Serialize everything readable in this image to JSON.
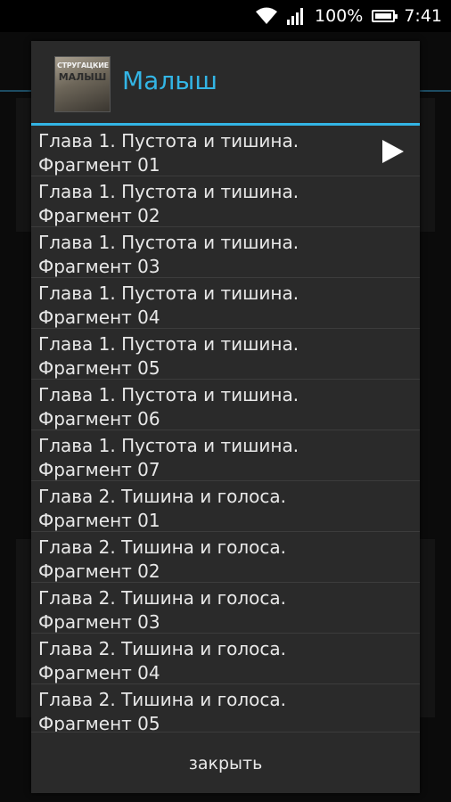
{
  "status_bar": {
    "battery_percent": "100%",
    "time": "7:41",
    "icons": [
      "wifi-icon",
      "signal-icon",
      "battery-icon"
    ]
  },
  "dialog": {
    "title": "Малыш",
    "cover_text_top": "СТРУГАЦКИЕ",
    "cover_text_main": "МАЛЫШ",
    "close_label": "закрыть",
    "accent_color": "#33b5e5",
    "items": [
      {
        "title": "Глава 1. Пустота и тишина.\nФрагмент 01",
        "playing": true
      },
      {
        "title": "Глава 1. Пустота и тишина.\nФрагмент 02"
      },
      {
        "title": "Глава 1. Пустота и тишина.\nФрагмент 03"
      },
      {
        "title": "Глава 1. Пустота и тишина.\nФрагмент 04"
      },
      {
        "title": "Глава 1. Пустота и тишина.\nФрагмент 05"
      },
      {
        "title": "Глава 1. Пустота и тишина.\nФрагмент 06"
      },
      {
        "title": "Глава 1. Пустота и тишина.\nФрагмент 07"
      },
      {
        "title": "Глава 2. Тишина и голоса.\nФрагмент 01"
      },
      {
        "title": "Глава 2. Тишина и голоса.\nФрагмент 02"
      },
      {
        "title": "Глава 2. Тишина и голоса.\nФрагмент 03"
      },
      {
        "title": "Глава 2. Тишина и голоса.\nФрагмент 04"
      },
      {
        "title": "Глава 2. Тишина и голоса.\nФрагмент 05"
      }
    ]
  }
}
